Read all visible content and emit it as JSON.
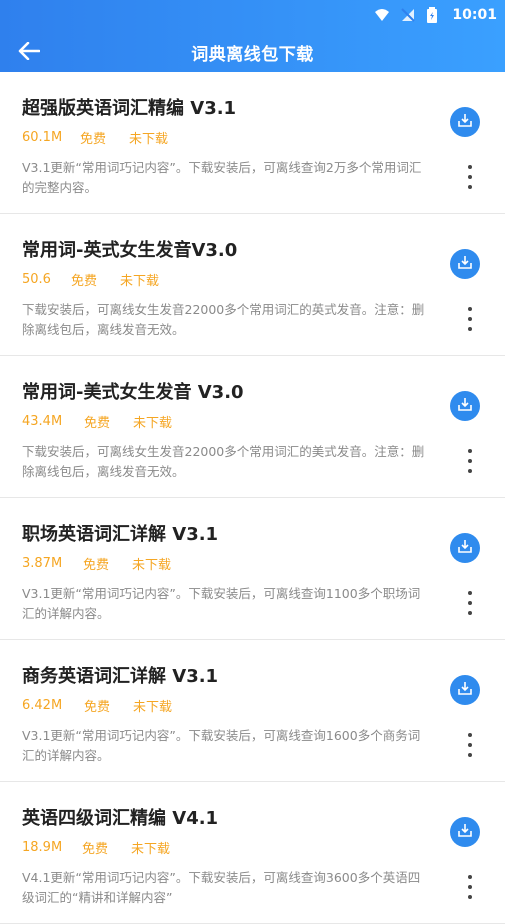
{
  "status": {
    "time": "10:01"
  },
  "header": {
    "title": "词典离线包下载",
    "back_icon": "arrow-left-icon"
  },
  "colors": {
    "accent": "#2f8bee",
    "meta": "#f5a623",
    "desc": "#8a8a8a"
  },
  "items": [
    {
      "title": "超强版英语词汇精编 V3.1",
      "size": "60.1M",
      "price": "免费",
      "status": "未下载",
      "desc": "V3.1更新“常用词巧记内容”。下载安装后，可离线查询2万多个常用词汇的完整内容。"
    },
    {
      "title": "常用词-英式女生发音V3.0",
      "size": "50.6",
      "price": "免费",
      "status": "未下载",
      "desc": "下载安装后，可离线女生发音22000多个常用词汇的英式发音。注意：删除离线包后，离线发音无效。"
    },
    {
      "title": "常用词-美式女生发音 V3.0",
      "size": "43.4M",
      "price": "免费",
      "status": "未下载",
      "desc": "下载安装后，可离线女生发音22000多个常用词汇的美式发音。注意：删除离线包后，离线发音无效。"
    },
    {
      "title": "职场英语词汇详解 V3.1",
      "size": "3.87M",
      "price": "免费",
      "status": "未下载",
      "desc": "V3.1更新“常用词巧记内容”。下载安装后，可离线查询1100多个职场词汇的详解内容。"
    },
    {
      "title": "商务英语词汇详解 V3.1",
      "size": "6.42M",
      "price": "免费",
      "status": "未下载",
      "desc": "V3.1更新“常用词巧记内容”。下载安装后，可离线查询1600多个商务词汇的详解内容。"
    },
    {
      "title": "英语四级词汇精编 V4.1",
      "size": "18.9M",
      "price": "免费",
      "status": "未下载",
      "desc": "V4.1更新“常用词巧记内容”。下载安装后，可离线查询3600多个英语四级词汇的“精讲和详解内容”"
    }
  ]
}
